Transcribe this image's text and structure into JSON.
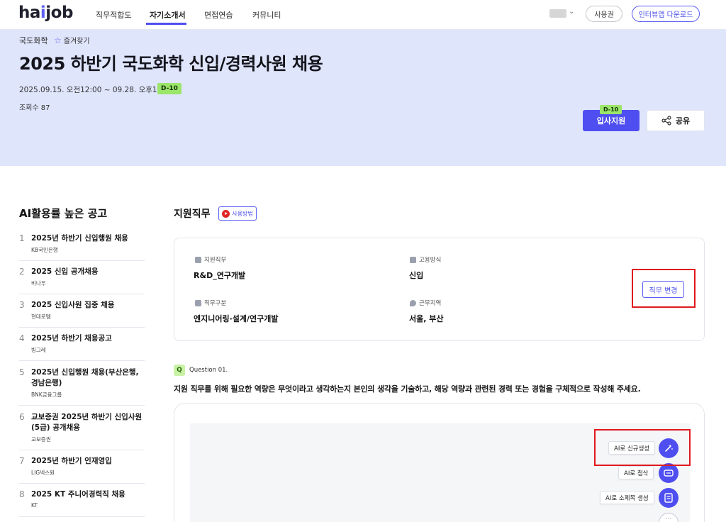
{
  "nav": {
    "logo_ha": "ha",
    "logo_i": "i",
    "logo_job": "job",
    "items": [
      "직무적합도",
      "자기소개서",
      "면접연습",
      "커뮤니티"
    ],
    "active_item": "자기소개서",
    "user_btn": "사용권",
    "download_btn": "인터뷰앱 다운로드"
  },
  "job": {
    "company": "국도화학",
    "favorite": "즐겨찾기",
    "title": "2025 하반기 국도화학 신입/경력사원 채용",
    "period": "2025.09.15. 오전12:00 ~ 09.28. 오후11:59",
    "dday": "D-10",
    "views": "조회수 87",
    "apply": "입사지원",
    "share": "공유"
  },
  "sidebar": {
    "title": "AI활용률 높은 공고",
    "items": [
      {
        "num": "1",
        "name": "2025년 하반기 신입행원 채용",
        "company": "KB국민은행"
      },
      {
        "num": "2",
        "name": "2025 신입 공개채용",
        "company": "비나우"
      },
      {
        "num": "3",
        "name": "2025 신입사원 집중 채용",
        "company": "현대로템"
      },
      {
        "num": "4",
        "name": "2025년 하반기 채용공고",
        "company": "빙그레"
      },
      {
        "num": "5",
        "name": "2025년 신입행원 채용(부산은행, 경남은행)",
        "company": "BNK금융그룹"
      },
      {
        "num": "6",
        "name": "교보증권 2025년 하반기 신입사원(5급) 공개채용",
        "company": "교보증권"
      },
      {
        "num": "7",
        "name": "2025년 하반기 인재영입",
        "company": "LIG넥스원"
      },
      {
        "num": "8",
        "name": "2025 KT 주니어경력직 채용",
        "company": "KT"
      }
    ]
  },
  "main": {
    "section_title": "지원직무",
    "howto": "사용방법",
    "fields": [
      {
        "label": "지원직무",
        "value": "R&D_연구개발"
      },
      {
        "label": "고용방식",
        "value": "신입"
      },
      {
        "label": "직무구분",
        "value": "엔지니어링·설계/연구개발"
      },
      {
        "label": "근무지역",
        "value": "서울, 부산"
      }
    ],
    "change_btn": "직무 변경",
    "question_badge": "Q",
    "question_num": "Question 01.",
    "question_text": "지원 직무를 위해 필요한 역량은 무엇이라고 생각하는지 본인의 생각을 기술하고, 해당 역량과 관련된 경력 또는 경험을 구체적으로 작성해 주세요.",
    "ai_actions": [
      "AI로 신규생성",
      "AI로 첨삭",
      "AI로 소제목 생성"
    ]
  }
}
